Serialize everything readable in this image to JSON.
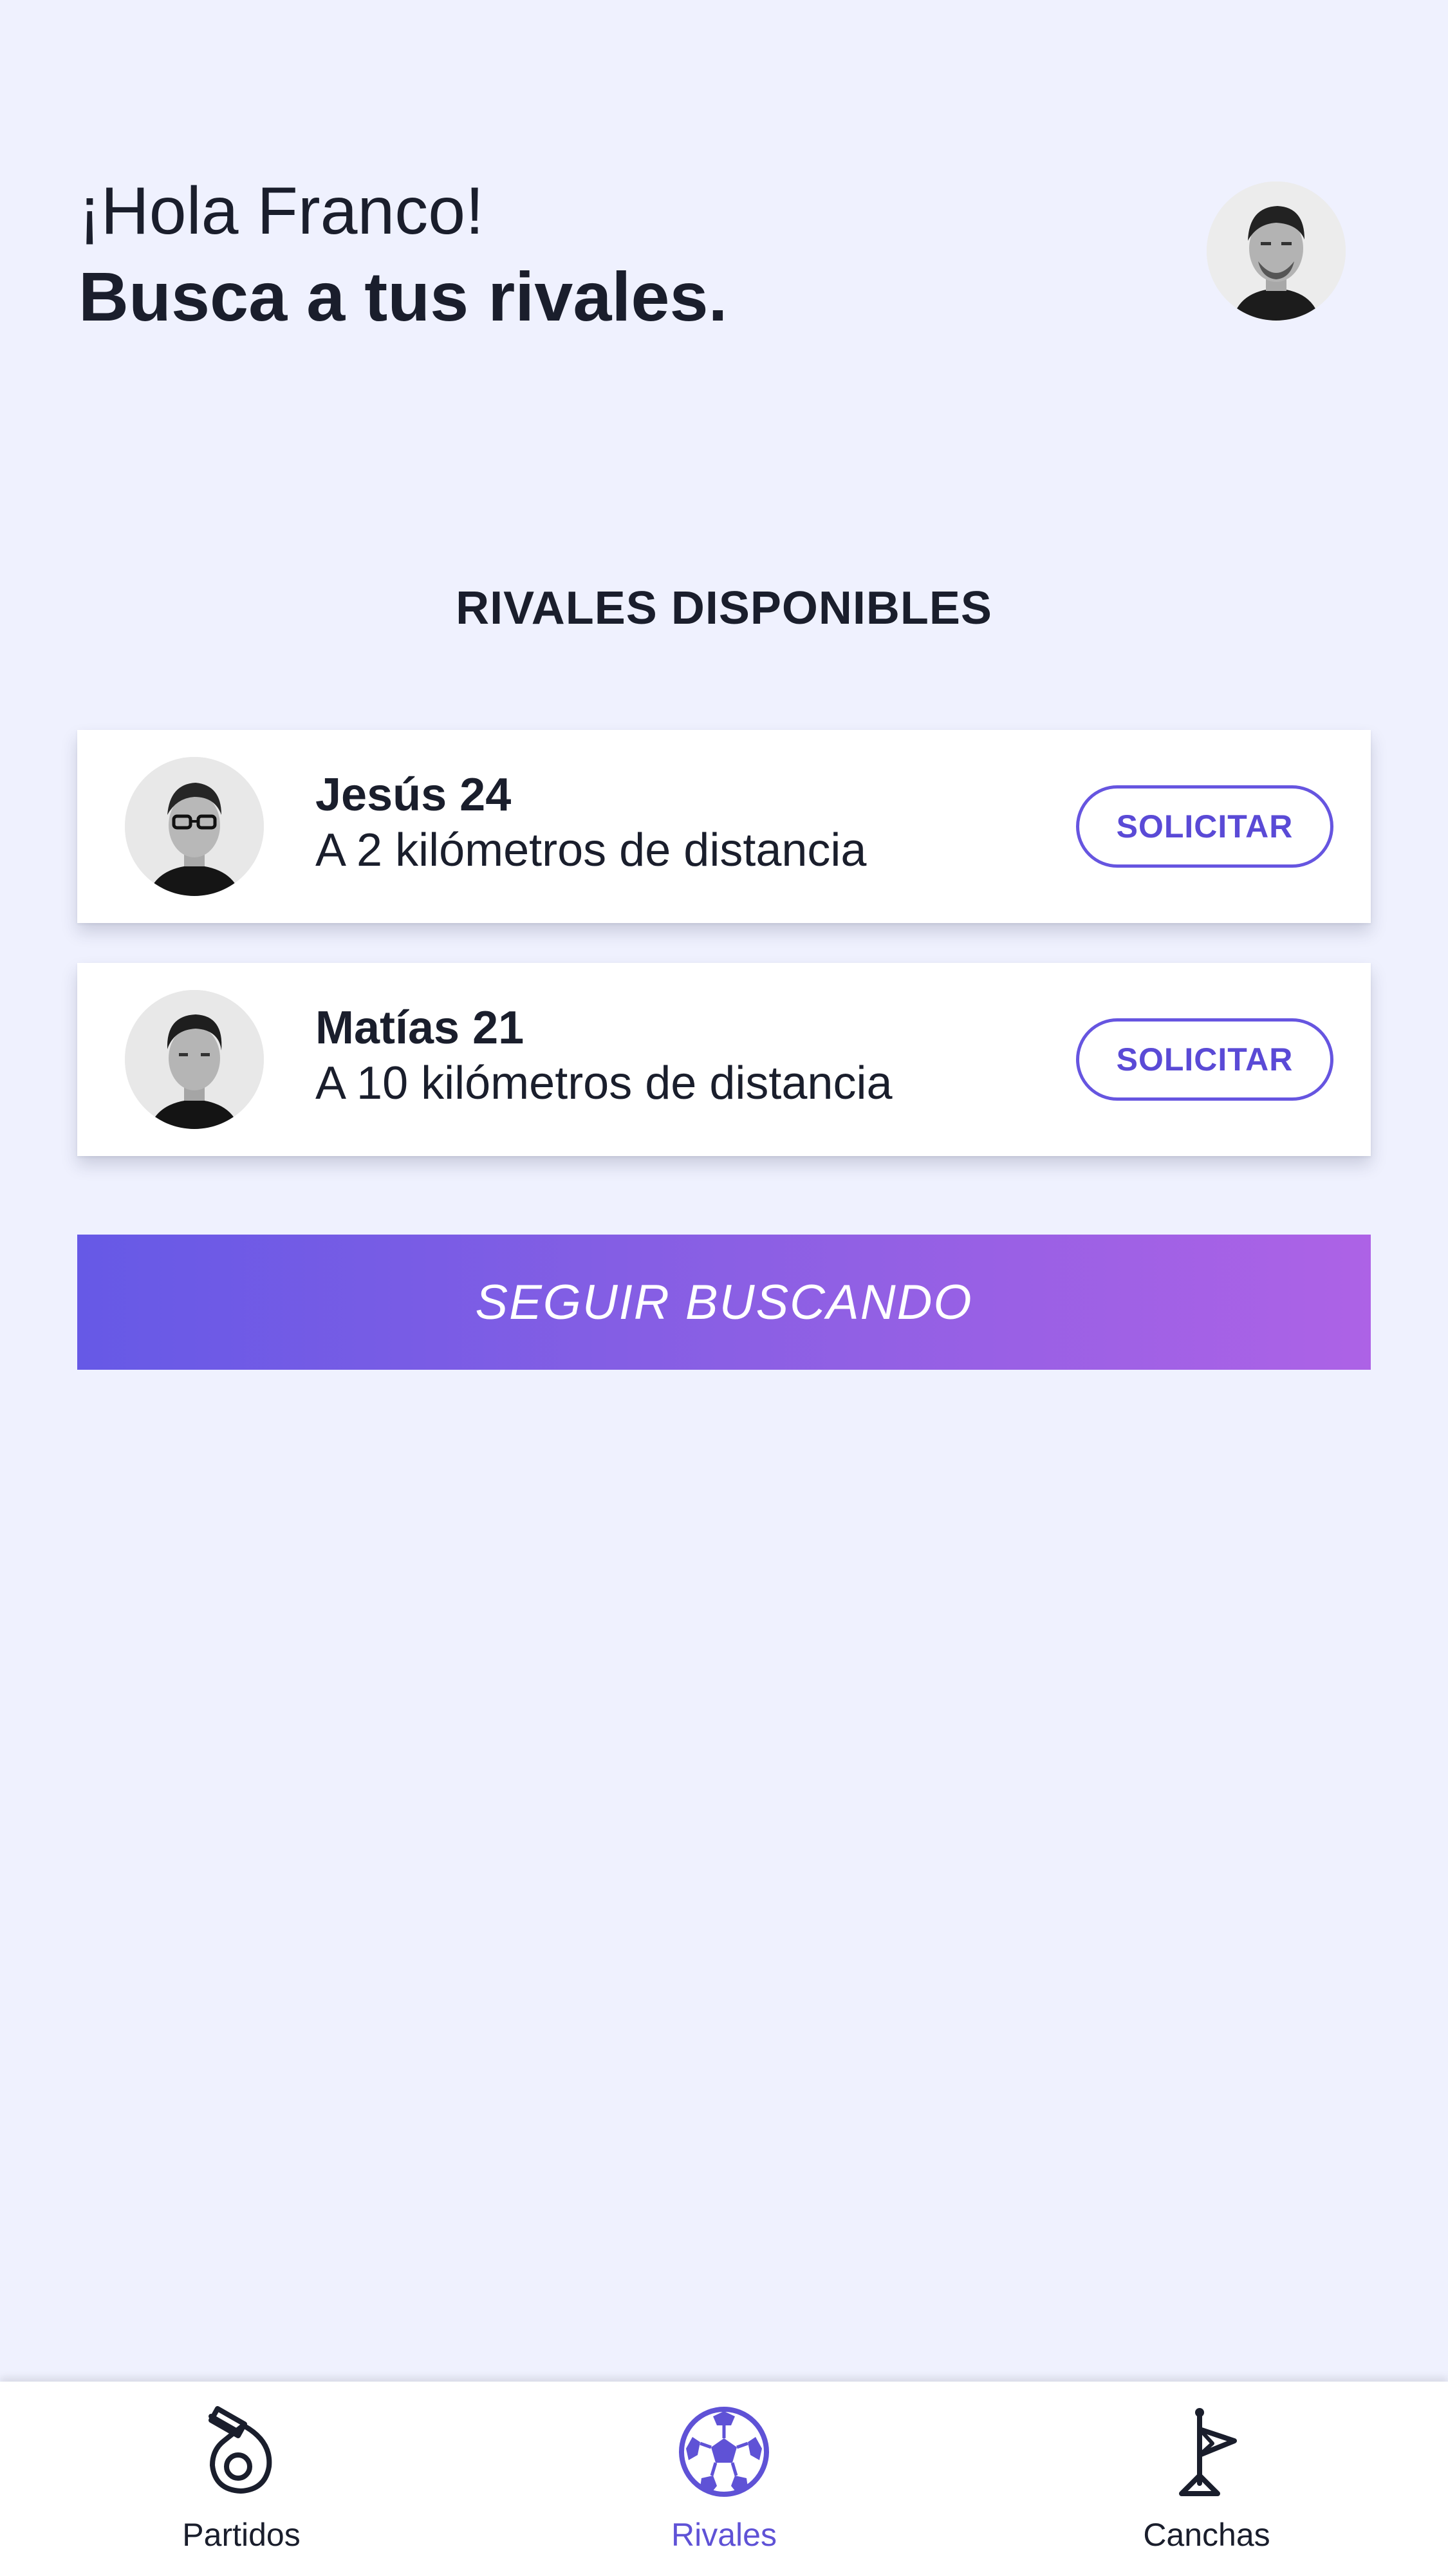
{
  "header": {
    "greeting": "¡Hola Franco!",
    "headline": "Busca a tus rivales."
  },
  "section_title": "RIVALES DISPONIBLES",
  "rivals": [
    {
      "name": "Jesús 24",
      "distance": "A 2 kilómetros de distancia",
      "button_label": "SOLICITAR"
    },
    {
      "name": "Matías 21",
      "distance": "A 10 kilómetros de distancia",
      "button_label": "SOLICITAR"
    }
  ],
  "keep_searching_label": "SEGUIR BUSCANDO",
  "bottom_nav": {
    "items": [
      {
        "label": "Partidos",
        "icon": "whistle-icon",
        "active": false
      },
      {
        "label": "Rivales",
        "icon": "soccer-ball-icon",
        "active": true
      },
      {
        "label": "Canchas",
        "icon": "corner-flag-icon",
        "active": false
      }
    ]
  },
  "colors": {
    "background": "#eff1fe",
    "accent": "#6655e0",
    "gradient_start": "#6659e6",
    "gradient_end": "#ad62e6",
    "text": "#1a1e2c"
  }
}
